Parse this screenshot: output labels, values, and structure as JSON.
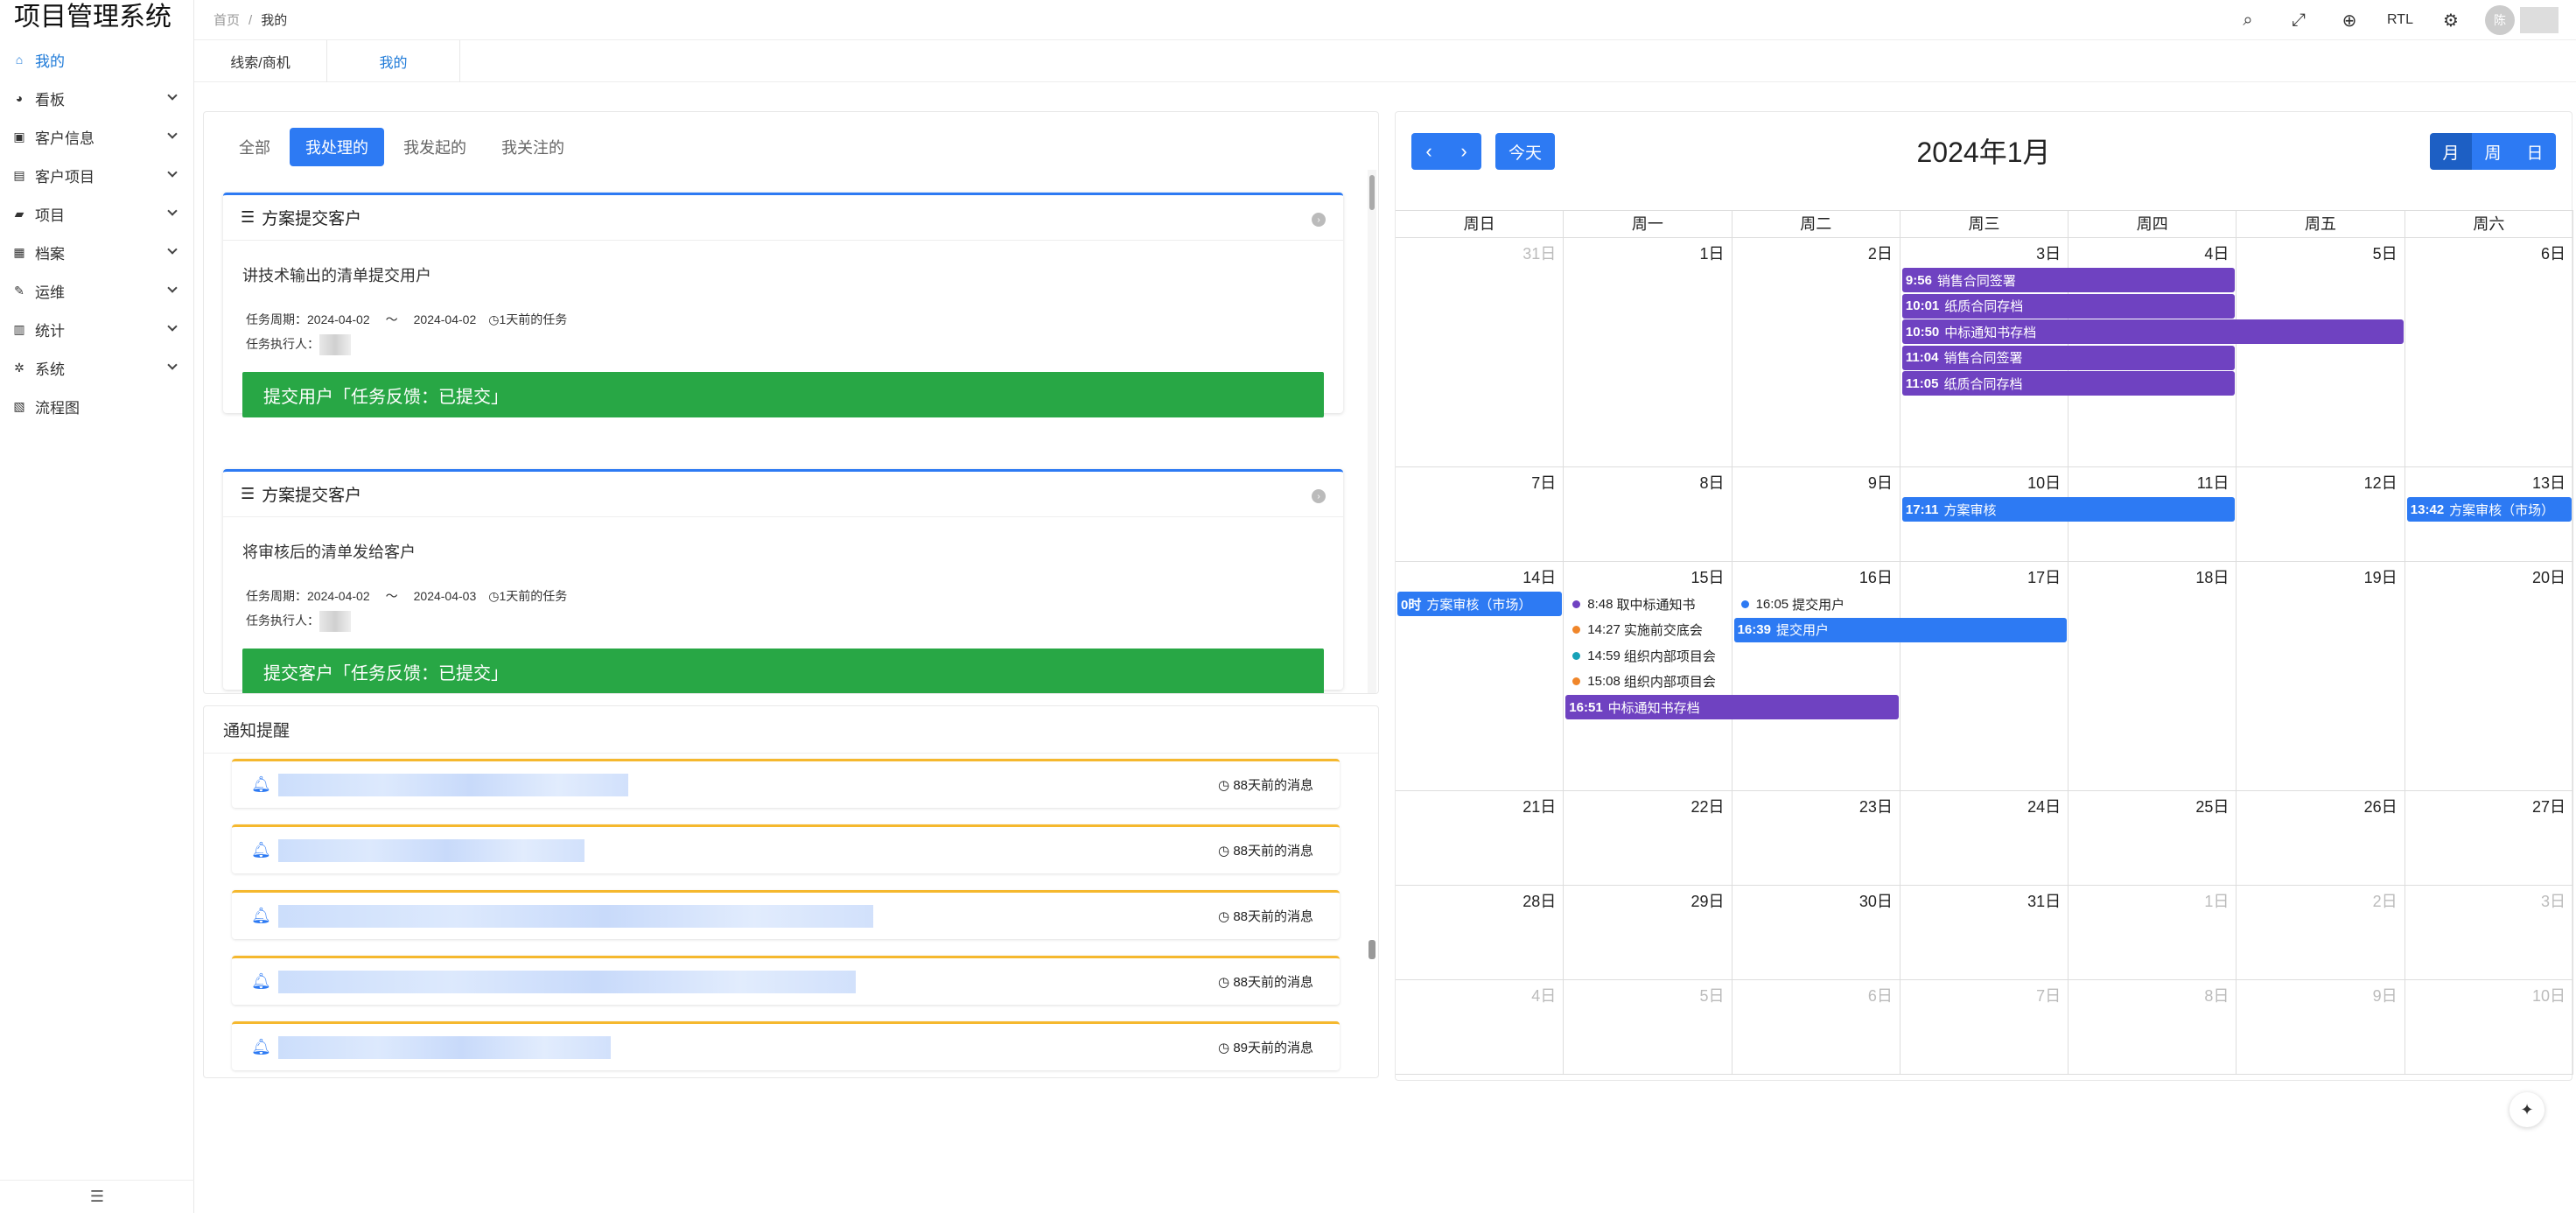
{
  "app": {
    "title": "项目管理系统"
  },
  "sidebar": {
    "items": [
      {
        "label": "我的",
        "icon": "home-icon",
        "glyph": "⌂",
        "active": true,
        "expandable": false
      },
      {
        "label": "看板",
        "icon": "dashboard-icon",
        "glyph": "◕",
        "active": false,
        "expandable": true
      },
      {
        "label": "客户信息",
        "icon": "contact-card-icon",
        "glyph": "▣",
        "active": false,
        "expandable": true
      },
      {
        "label": "客户项目",
        "icon": "user-card-icon",
        "glyph": "▤",
        "active": false,
        "expandable": true
      },
      {
        "label": "项目",
        "icon": "folder-icon",
        "glyph": "▰",
        "active": false,
        "expandable": true
      },
      {
        "label": "档案",
        "icon": "archive-icon",
        "glyph": "▦",
        "active": false,
        "expandable": true
      },
      {
        "label": "运维",
        "icon": "wrench-icon",
        "glyph": "✎",
        "active": false,
        "expandable": true
      },
      {
        "label": "统计",
        "icon": "list-icon",
        "glyph": "▥",
        "active": false,
        "expandable": true
      },
      {
        "label": "系统",
        "icon": "gear-icon",
        "glyph": "✲",
        "active": false,
        "expandable": true
      },
      {
        "label": "流程图",
        "icon": "map-icon",
        "glyph": "▧",
        "active": false,
        "expandable": false
      }
    ]
  },
  "header": {
    "breadcrumb": [
      "首页",
      "我的"
    ],
    "breadcrumb_sep": "/",
    "rtl_label": "RTL",
    "avatar_text": "陈"
  },
  "page_tabs": [
    "线索/商机",
    "我的"
  ],
  "tasks": {
    "filter_tabs": [
      "全部",
      "我处理的",
      "我发起的",
      "我关注的"
    ],
    "active_filter": 1,
    "period_label": "任务周期：",
    "assignee_label": "任务执行人：",
    "items": [
      {
        "title": "方案提交客户",
        "desc": "讲技术输出的清单提交用户",
        "start": "2024-04-02",
        "end": "2024-04-02",
        "ago": "1天前的任务",
        "action": "提交用户「任务反馈：已提交」"
      },
      {
        "title": "方案提交客户",
        "desc": "将审核后的清单发给客户",
        "start": "2024-04-02",
        "end": "2024-04-03",
        "ago": "1天前的任务",
        "action": "提交客户「任务反馈：已提交」"
      }
    ]
  },
  "notices": {
    "title": "通知提醒",
    "items": [
      {
        "ago": "88天前的消息"
      },
      {
        "ago": "88天前的消息"
      },
      {
        "ago": "88天前的消息"
      },
      {
        "ago": "88天前的消息"
      },
      {
        "ago": "89天前的消息"
      }
    ]
  },
  "calendar": {
    "title": "2024年1月",
    "today_label": "今天",
    "views": [
      "月",
      "周",
      "日"
    ],
    "active_view": 0,
    "weekdays": [
      "周日",
      "周一",
      "周二",
      "周三",
      "周四",
      "周五",
      "周六"
    ],
    "weeks": [
      [
        {
          "d": "31日",
          "o": true
        },
        {
          "d": "1日"
        },
        {
          "d": "2日"
        },
        {
          "d": "3日"
        },
        {
          "d": "4日"
        },
        {
          "d": "5日"
        },
        {
          "d": "6日"
        }
      ],
      [
        {
          "d": "7日"
        },
        {
          "d": "8日"
        },
        {
          "d": "9日"
        },
        {
          "d": "10日"
        },
        {
          "d": "11日"
        },
        {
          "d": "12日"
        },
        {
          "d": "13日"
        }
      ],
      [
        {
          "d": "14日"
        },
        {
          "d": "15日"
        },
        {
          "d": "16日"
        },
        {
          "d": "17日"
        },
        {
          "d": "18日"
        },
        {
          "d": "19日"
        },
        {
          "d": "20日"
        }
      ],
      [
        {
          "d": "21日"
        },
        {
          "d": "22日"
        },
        {
          "d": "23日"
        },
        {
          "d": "24日"
        },
        {
          "d": "25日"
        },
        {
          "d": "26日"
        },
        {
          "d": "27日"
        }
      ],
      [
        {
          "d": "28日"
        },
        {
          "d": "29日"
        },
        {
          "d": "30日"
        },
        {
          "d": "31日"
        },
        {
          "d": "1日",
          "o": true
        },
        {
          "d": "2日",
          "o": true
        },
        {
          "d": "3日",
          "o": true
        }
      ],
      [
        {
          "d": "4日",
          "o": true
        },
        {
          "d": "5日",
          "o": true
        },
        {
          "d": "6日",
          "o": true
        },
        {
          "d": "7日",
          "o": true
        },
        {
          "d": "8日",
          "o": true
        },
        {
          "d": "9日",
          "o": true
        },
        {
          "d": "10日",
          "o": true
        }
      ]
    ],
    "colors": {
      "purple": "#6f42c1",
      "blue": "#2d7af3",
      "dot_purple": "#6f42c1",
      "dot_orange": "#f0862a",
      "dot_teal": "#17a2b8",
      "dot_blue": "#2d7af3"
    },
    "bar_events": [
      {
        "week": 0,
        "startCol": 3,
        "span": 2,
        "slot": 0,
        "time": "9:56",
        "title": "销售合同签署",
        "color": "purple"
      },
      {
        "week": 0,
        "startCol": 3,
        "span": 2,
        "slot": 1,
        "time": "10:01",
        "title": "纸质合同存档",
        "color": "purple"
      },
      {
        "week": 0,
        "startCol": 3,
        "span": 3,
        "slot": 2,
        "time": "10:50",
        "title": "中标通知书存档",
        "color": "purple"
      },
      {
        "week": 0,
        "startCol": 3,
        "span": 2,
        "slot": 3,
        "time": "11:04",
        "title": "销售合同签署",
        "color": "purple"
      },
      {
        "week": 0,
        "startCol": 3,
        "span": 2,
        "slot": 4,
        "time": "11:05",
        "title": "纸质合同存档",
        "color": "purple"
      },
      {
        "week": 1,
        "startCol": 3,
        "span": 2,
        "slot": 0,
        "time": "17:11",
        "title": "方案审核",
        "color": "blue"
      },
      {
        "week": 1,
        "startCol": 6,
        "span": 1,
        "slot": 0,
        "time": "13:42",
        "title": "方案审核（市场）",
        "color": "blue"
      },
      {
        "week": 2,
        "startCol": 0,
        "span": 1,
        "slot": 0,
        "time": "0时",
        "title": "方案审核（市场）",
        "color": "blue"
      },
      {
        "week": 2,
        "startCol": 2,
        "span": 2,
        "slot": 1,
        "time": "16:39",
        "title": "提交用户",
        "color": "blue"
      },
      {
        "week": 2,
        "startCol": 1,
        "span": 2,
        "slot": 4,
        "time": "16:51",
        "title": "中标通知书存档",
        "color": "purple"
      }
    ],
    "dot_events": [
      {
        "week": 2,
        "col": 1,
        "slot": 0,
        "time": "8:48",
        "title": "取中标通知书",
        "color": "dot_purple"
      },
      {
        "week": 2,
        "col": 1,
        "slot": 1,
        "time": "14:27",
        "title": "实施前交底会",
        "color": "dot_orange"
      },
      {
        "week": 2,
        "col": 1,
        "slot": 2,
        "time": "14:59",
        "title": "组织内部项目会",
        "color": "dot_teal"
      },
      {
        "week": 2,
        "col": 1,
        "slot": 3,
        "time": "15:08",
        "title": "组织内部项目会",
        "color": "dot_orange"
      },
      {
        "week": 2,
        "col": 2,
        "slot": 0,
        "time": "16:05",
        "title": "提交用户",
        "color": "dot_blue"
      }
    ]
  }
}
